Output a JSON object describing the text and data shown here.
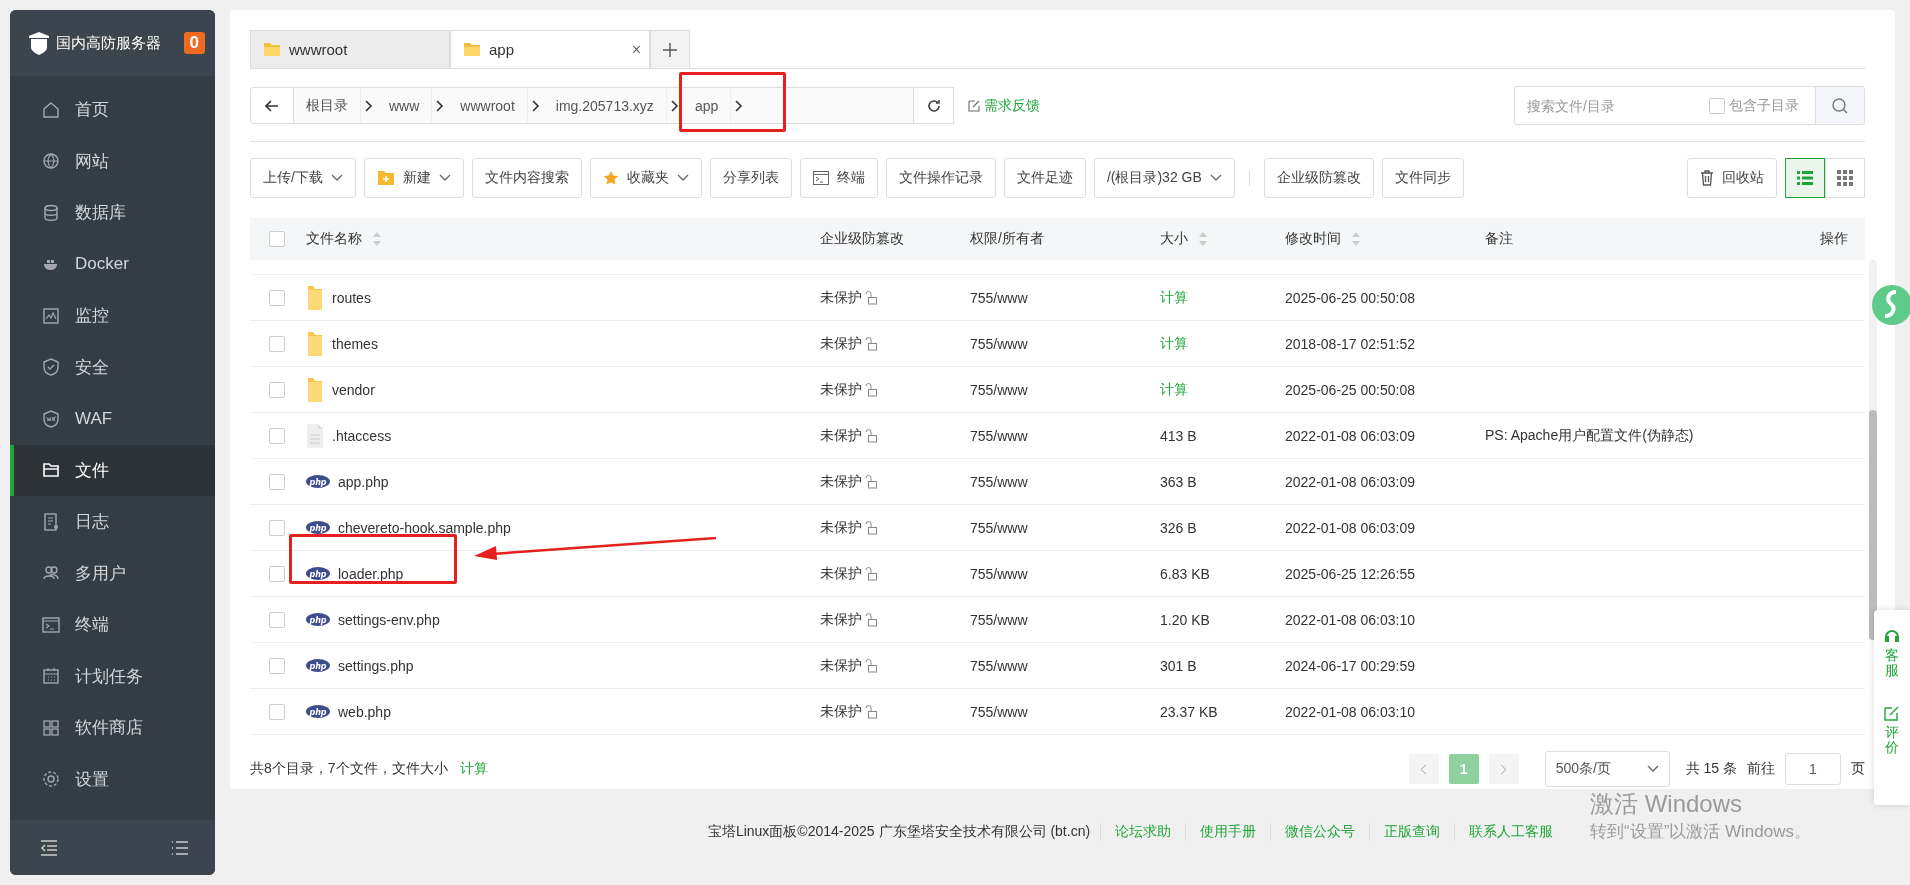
{
  "sidebar": {
    "brand": "国内高防服务器",
    "badge": "0",
    "items": [
      {
        "label": "首页",
        "selected": false
      },
      {
        "label": "网站",
        "selected": false
      },
      {
        "label": "数据库",
        "selected": false
      },
      {
        "label": "Docker",
        "selected": false
      },
      {
        "label": "监控",
        "selected": false
      },
      {
        "label": "安全",
        "selected": false
      },
      {
        "label": "WAF",
        "selected": false
      },
      {
        "label": "文件",
        "selected": true
      },
      {
        "label": "日志",
        "selected": false
      },
      {
        "label": "多用户",
        "selected": false
      },
      {
        "label": "终端",
        "selected": false
      },
      {
        "label": "计划任务",
        "selected": false
      },
      {
        "label": "软件商店",
        "selected": false
      },
      {
        "label": "设置",
        "selected": false
      }
    ]
  },
  "tabs": [
    {
      "label": "wwwroot",
      "selected": false
    },
    {
      "label": "app",
      "selected": true,
      "close": "×"
    }
  ],
  "breadcrumb": {
    "segments": [
      "根目录",
      "www",
      "wwwroot",
      "img.205713.xyz",
      "app"
    ],
    "feedback": "需求反馈"
  },
  "search": {
    "placeholder": "搜索文件/目录",
    "include_subdirs": {
      "label": "包含子目录",
      "checked": false
    }
  },
  "toolbar": [
    {
      "label": "上传/下载",
      "kind": "dropdown"
    },
    {
      "label": "新建",
      "kind": "create"
    },
    {
      "label": "文件内容搜索",
      "kind": "plain"
    },
    {
      "label": "收藏夹",
      "kind": "favorites"
    },
    {
      "label": "分享列表",
      "kind": "plain"
    },
    {
      "label": "终端",
      "kind": "terminal"
    },
    {
      "label": "文件操作记录",
      "kind": "plain"
    },
    {
      "label": "文件足迹",
      "kind": "plain"
    },
    {
      "label": "/(根目录)32 GB",
      "kind": "dropdown"
    },
    {
      "kind": "separator"
    },
    {
      "label": "企业级防篡改",
      "kind": "plain"
    },
    {
      "label": "文件同步",
      "kind": "plain"
    }
  ],
  "recycle_bin": "回收站",
  "view_modes": [
    {
      "kind": "list",
      "selected": true
    },
    {
      "kind": "grid",
      "selected": false
    }
  ],
  "table": {
    "select_all": {
      "checked": false
    },
    "columns": [
      {
        "label": "文件名称",
        "sortable": true
      },
      {
        "label": "企业级防篡改",
        "sortable": false
      },
      {
        "label": "权限/所有者",
        "sortable": false
      },
      {
        "label": "大小",
        "sortable": true
      },
      {
        "label": "修改时间",
        "sortable": true
      },
      {
        "label": "备注",
        "sortable": false
      },
      {
        "label": "操作",
        "sortable": false
      }
    ],
    "rows": [
      {
        "kind": "folder",
        "checked": false,
        "name": "routes",
        "protection": "未保护",
        "permission": "755/www",
        "size": "计算",
        "size_action": true,
        "modified": "2025-06-25 00:50:08"
      },
      {
        "kind": "folder",
        "checked": false,
        "name": "themes",
        "protection": "未保护",
        "permission": "755/www",
        "size": "计算",
        "size_action": true,
        "modified": "2018-08-17 02:51:52"
      },
      {
        "kind": "folder",
        "checked": false,
        "name": "vendor",
        "protection": "未保护",
        "permission": "755/www",
        "size": "计算",
        "size_action": true,
        "modified": "2025-06-25 00:50:08"
      },
      {
        "kind": "file",
        "checked": false,
        "name": ".htaccess",
        "protection": "未保护",
        "permission": "755/www",
        "size": "413 B",
        "size_action": false,
        "modified": "2022-01-08 06:03:09",
        "note": "PS: Apache用户配置文件(伪静态)"
      },
      {
        "kind": "php",
        "checked": false,
        "name": "app.php",
        "protection": "未保护",
        "permission": "755/www",
        "size": "363 B",
        "size_action": false,
        "modified": "2022-01-08 06:03:09"
      },
      {
        "kind": "php",
        "checked": false,
        "name": "chevereto-hook.sample.php",
        "protection": "未保护",
        "permission": "755/www",
        "size": "326 B",
        "size_action": false,
        "modified": "2022-01-08 06:03:09"
      },
      {
        "kind": "php",
        "checked": false,
        "name": "loader.php",
        "protection": "未保护",
        "permission": "755/www",
        "size": "6.83 KB",
        "size_action": false,
        "modified": "2025-06-25 12:26:55"
      },
      {
        "kind": "php",
        "checked": false,
        "name": "settings-env.php",
        "protection": "未保护",
        "permission": "755/www",
        "size": "1.20 KB",
        "size_action": false,
        "modified": "2022-01-08 06:03:10"
      },
      {
        "kind": "php",
        "checked": false,
        "name": "settings.php",
        "protection": "未保护",
        "permission": "755/www",
        "size": "301 B",
        "size_action": false,
        "modified": "2024-06-17 00:29:59"
      },
      {
        "kind": "php",
        "checked": false,
        "name": "web.php",
        "protection": "未保护",
        "permission": "755/www",
        "size": "23.37 KB",
        "size_action": false,
        "modified": "2022-01-08 06:03:10"
      }
    ]
  },
  "summary": {
    "text": "共8个目录，7个文件，文件大小",
    "action": "计算"
  },
  "pagination": {
    "pages": [
      {
        "label": "1",
        "selected": true
      }
    ],
    "page_size": "500条/页",
    "total": "共 15 条",
    "goto_label": "前往",
    "goto_value": "1",
    "page_unit": "页"
  },
  "footer": {
    "copyright": "宝塔Linux面板©2014-2025 广东堡塔安全技术有限公司 (bt.cn)",
    "links": [
      "论坛求助",
      "使用手册",
      "微信公众号",
      "正版查询",
      "联系人工客服"
    ]
  },
  "float_panel": [
    "客服",
    "评价"
  ],
  "windows_notice": {
    "title": "激活 Windows",
    "subtitle": "转到“设置”以激活 Windows。"
  }
}
